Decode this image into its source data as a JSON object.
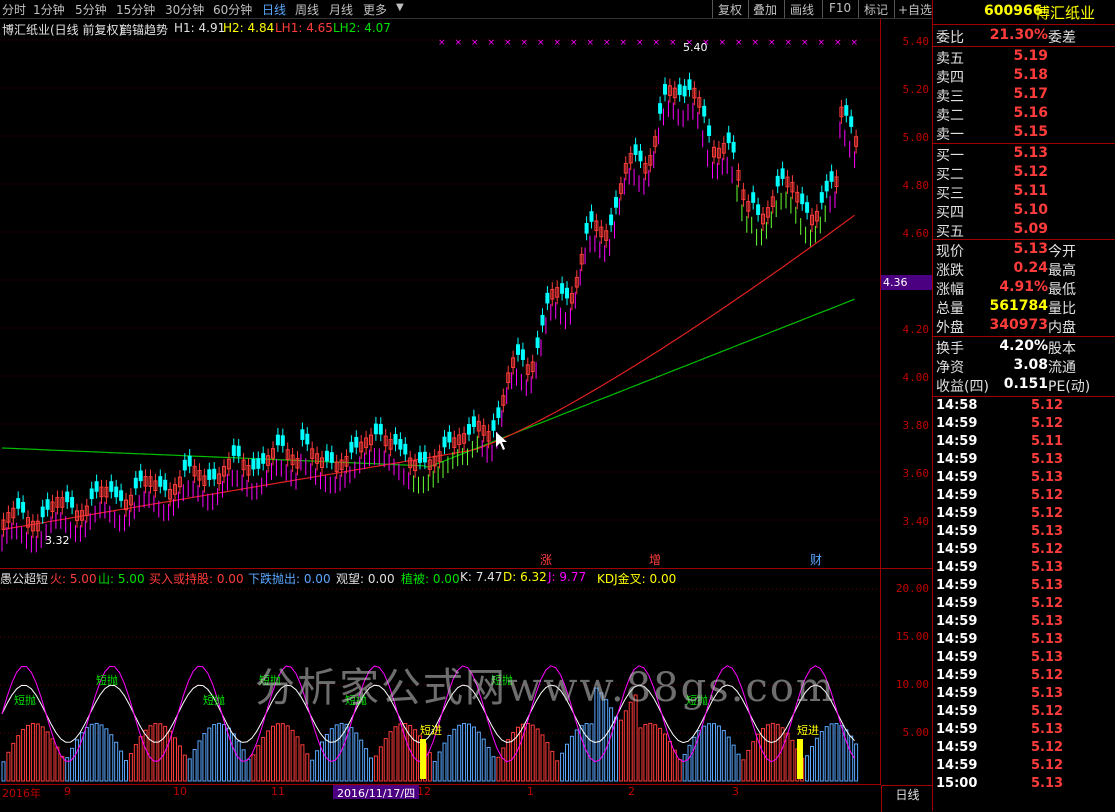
{
  "toolbar": {
    "periods": [
      "分时",
      "1分钟",
      "5分钟",
      "15分钟",
      "30分钟",
      "60分钟",
      "日线",
      "周线",
      "月线",
      "更多"
    ],
    "active_period": "日线",
    "right_buttons": [
      "复权",
      "叠加",
      "画线",
      "F10",
      "标记",
      "+自选"
    ]
  },
  "main_chart": {
    "title": "博汇纸业(日线 前复权)",
    "indicator": "鹤锚趋势",
    "h1": "H1: 4.91",
    "h2": "H2: 4.84",
    "lh1": "LH1: 4.65",
    "lh2": "LH2: 4.07",
    "high_label": "5.40",
    "low_label": "3.32",
    "price_marker": "4.36",
    "y_ticks": [
      "5.40",
      "5.20",
      "5.00",
      "4.80",
      "4.60",
      "4.40",
      "4.20",
      "4.00",
      "3.80",
      "3.60",
      "3.40"
    ],
    "event_labels": [
      "涨",
      "增",
      "财"
    ]
  },
  "sub_chart": {
    "name": "愚公超短",
    "fire": "火: 5.00",
    "mountain": "山: 5.00",
    "buy_hold": "买入或持股: 0.00",
    "fall_sell": "下跌抛出: 0.00",
    "watch": "观望: 0.00",
    "plant": "植被: 0.00",
    "k": "K: 7.47",
    "d": "D: 6.32",
    "j": "J: 9.77",
    "kdj_cross": "KDJ金叉: 0.00",
    "y_ticks": [
      "20.00",
      "15.00",
      "10.00",
      "5.00"
    ],
    "signals": [
      "短抛",
      "短抛",
      "短抛",
      "短抛",
      "短抛",
      "短抛",
      "短抛",
      "短进",
      "短进"
    ]
  },
  "date_axis": {
    "labels": [
      "2016年",
      "9",
      "10",
      "11",
      "12",
      "1",
      "2",
      "3"
    ],
    "cursor_date": "2016/11/17/四",
    "period_label": "日线"
  },
  "watermark": "分析家公式网www.88gs.com",
  "quote": {
    "code": "600966",
    "name": "博汇纸业",
    "weibi_label": "委比",
    "weibi_value": "21.30%",
    "weicha_label": "委差",
    "asks": [
      {
        "label": "卖五",
        "price": "5.19"
      },
      {
        "label": "卖四",
        "price": "5.18"
      },
      {
        "label": "卖三",
        "price": "5.17"
      },
      {
        "label": "卖二",
        "price": "5.16"
      },
      {
        "label": "卖一",
        "price": "5.15"
      }
    ],
    "bids": [
      {
        "label": "买一",
        "price": "5.13"
      },
      {
        "label": "买二",
        "price": "5.12"
      },
      {
        "label": "买三",
        "price": "5.11"
      },
      {
        "label": "买四",
        "price": "5.10"
      },
      {
        "label": "买五",
        "price": "5.09"
      }
    ],
    "stats": [
      {
        "label": "现价",
        "value": "5.13",
        "label2": "今开",
        "color": "red"
      },
      {
        "label": "涨跌",
        "value": "0.24",
        "label2": "最高",
        "color": "red"
      },
      {
        "label": "涨幅",
        "value": "4.91%",
        "label2": "最低",
        "color": "red"
      },
      {
        "label": "总量",
        "value": "561784",
        "label2": "量比",
        "color": "yellow"
      },
      {
        "label": "外盘",
        "value": "340973",
        "label2": "内盘",
        "color": "red"
      }
    ],
    "stats2": [
      {
        "label": "换手",
        "value": "4.20%",
        "label2": "股本",
        "color": "white"
      },
      {
        "label": "净资",
        "value": "3.08",
        "label2": "流通",
        "color": "white"
      },
      {
        "label": "收益(四)",
        "value": "0.151",
        "label2": "PE(动)",
        "color": "white"
      }
    ],
    "ticks": [
      {
        "time": "14:58",
        "price": "5.12"
      },
      {
        "time": "14:59",
        "price": "5.12"
      },
      {
        "time": "14:59",
        "price": "5.11"
      },
      {
        "time": "14:59",
        "price": "5.13"
      },
      {
        "time": "14:59",
        "price": "5.13"
      },
      {
        "time": "14:59",
        "price": "5.12"
      },
      {
        "time": "14:59",
        "price": "5.12"
      },
      {
        "time": "14:59",
        "price": "5.13"
      },
      {
        "time": "14:59",
        "price": "5.12"
      },
      {
        "time": "14:59",
        "price": "5.13"
      },
      {
        "time": "14:59",
        "price": "5.13"
      },
      {
        "time": "14:59",
        "price": "5.12"
      },
      {
        "time": "14:59",
        "price": "5.13"
      },
      {
        "time": "14:59",
        "price": "5.13"
      },
      {
        "time": "14:59",
        "price": "5.13"
      },
      {
        "time": "14:59",
        "price": "5.12"
      },
      {
        "time": "14:59",
        "price": "5.13"
      },
      {
        "time": "14:59",
        "price": "5.12"
      },
      {
        "time": "14:59",
        "price": "5.13"
      },
      {
        "time": "14:59",
        "price": "5.12"
      },
      {
        "time": "14:59",
        "price": "5.12"
      },
      {
        "time": "15:00",
        "price": "5.13"
      }
    ]
  },
  "colors": {
    "up": "#ff3c3c",
    "down": "#00ffff",
    "ribbon_up": "#ff00ff",
    "ribbon_down": "#66ff33",
    "ma_red": "#e02020",
    "ma_green": "#00c000",
    "axis": "#a00000"
  }
}
